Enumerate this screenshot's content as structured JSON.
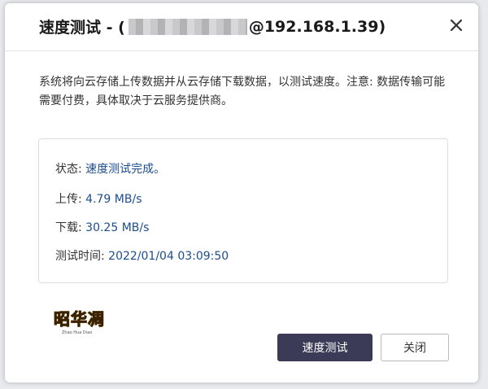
{
  "dialog": {
    "title_prefix": "速度测试 - (",
    "title_suffix": "@192.168.1.39)",
    "description": "系统将向云存储上传数据并从云存储下载数据，以测试速度。注意: 数据传输可能需要付费，具体取决于云服务提供商。",
    "close_icon": "close-icon"
  },
  "results": {
    "status_label": "状态:",
    "status_value": "速度测试完成。",
    "upload_label": "上传:",
    "upload_value": "4.79 MB/s",
    "download_label": "下载:",
    "download_value": "30.25 MB/s",
    "time_label": "测试时间:",
    "time_value": "2022/01/04 03:09:50"
  },
  "watermark": {
    "text": "昭华凋",
    "sub": "Zhao Hua Diao"
  },
  "buttons": {
    "speed_test": "速度测试",
    "close": "关闭"
  },
  "colors": {
    "primary_button": "#3b3b58",
    "value_text": "#1c4d8f"
  }
}
